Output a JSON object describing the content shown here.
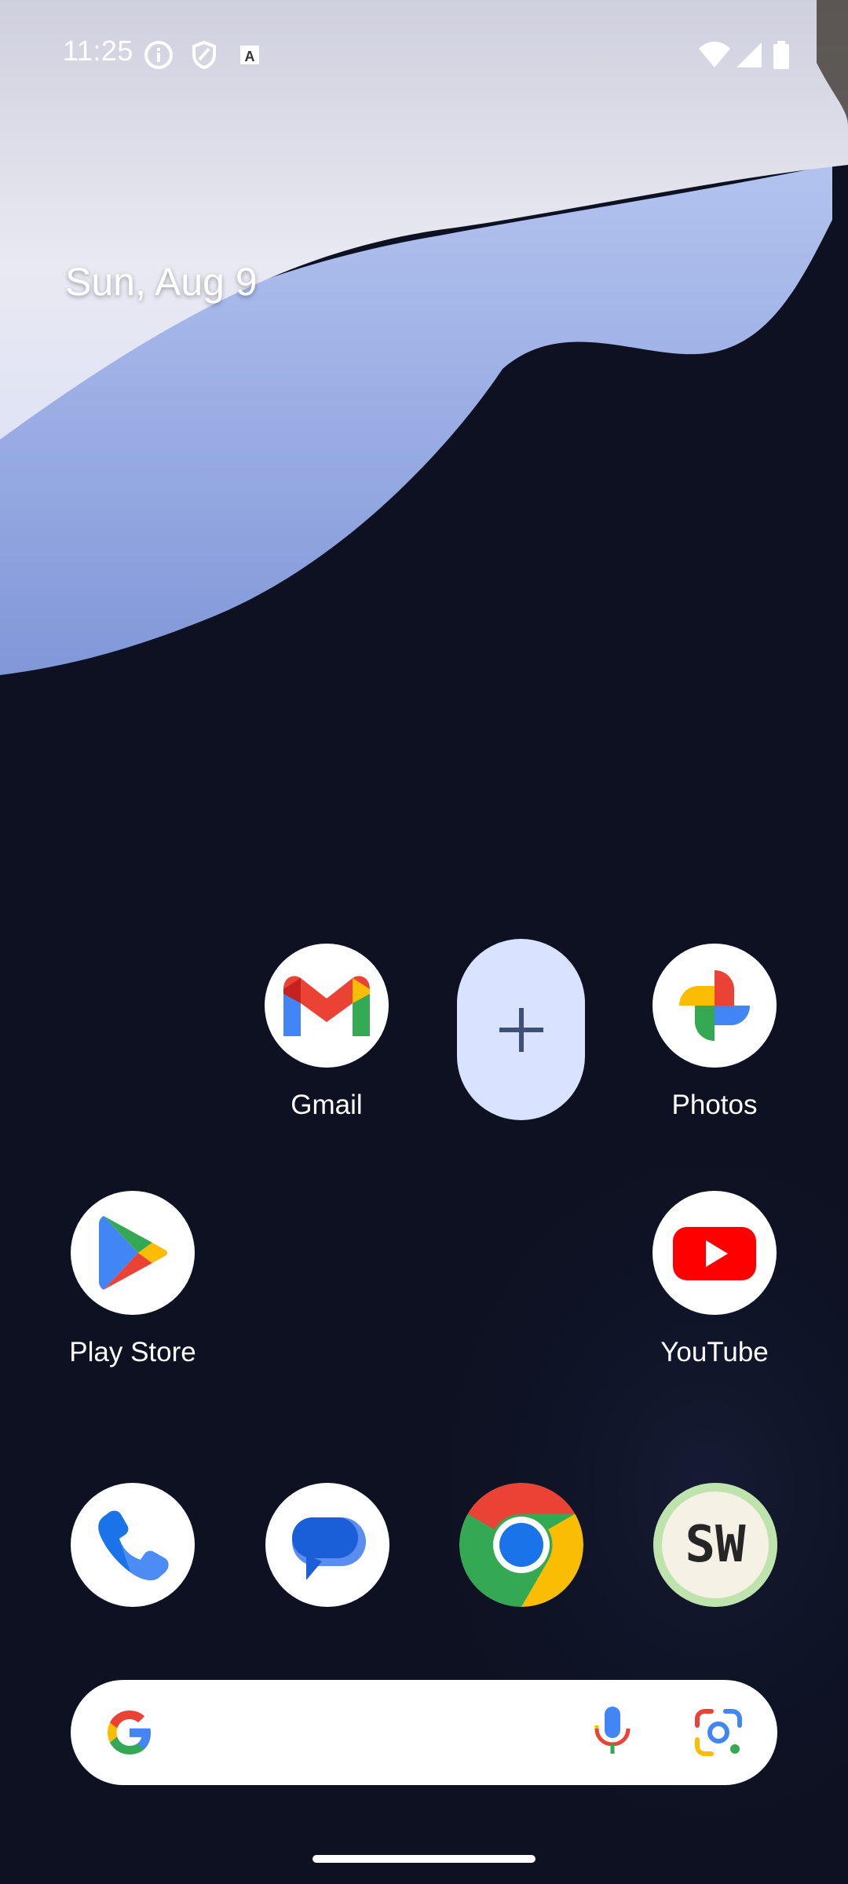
{
  "status_bar": {
    "time": "11:25",
    "left_icons": [
      "info-icon",
      "shield-icon",
      "keyboard-a-icon"
    ],
    "right_icons": [
      "wifi-icon",
      "cell-signal-icon",
      "battery-icon"
    ]
  },
  "date": "Sun, Aug 9",
  "home_apps": [
    {
      "label": "Gmail",
      "icon": "gmail-icon"
    },
    {
      "label": "Photos",
      "icon": "photos-icon"
    },
    {
      "label": "Play Store",
      "icon": "play-store-icon"
    },
    {
      "label": "YouTube",
      "icon": "youtube-icon"
    }
  ],
  "add_widget": {
    "icon": "plus-icon"
  },
  "dock": [
    {
      "icon": "phone-icon"
    },
    {
      "icon": "messages-icon"
    },
    {
      "icon": "chrome-icon"
    },
    {
      "icon": "sw-app-icon",
      "text": "SW"
    }
  ],
  "search_bar": {
    "icons": [
      "google-g-icon",
      "microphone-icon",
      "lens-icon"
    ]
  },
  "colors": {
    "background": "#0d1122",
    "add_widget": "#d9e2ff",
    "plus": "#3f4f7a",
    "wallpaper_light": "#e7e7f0",
    "wallpaper_blue": "#93a9e6"
  }
}
